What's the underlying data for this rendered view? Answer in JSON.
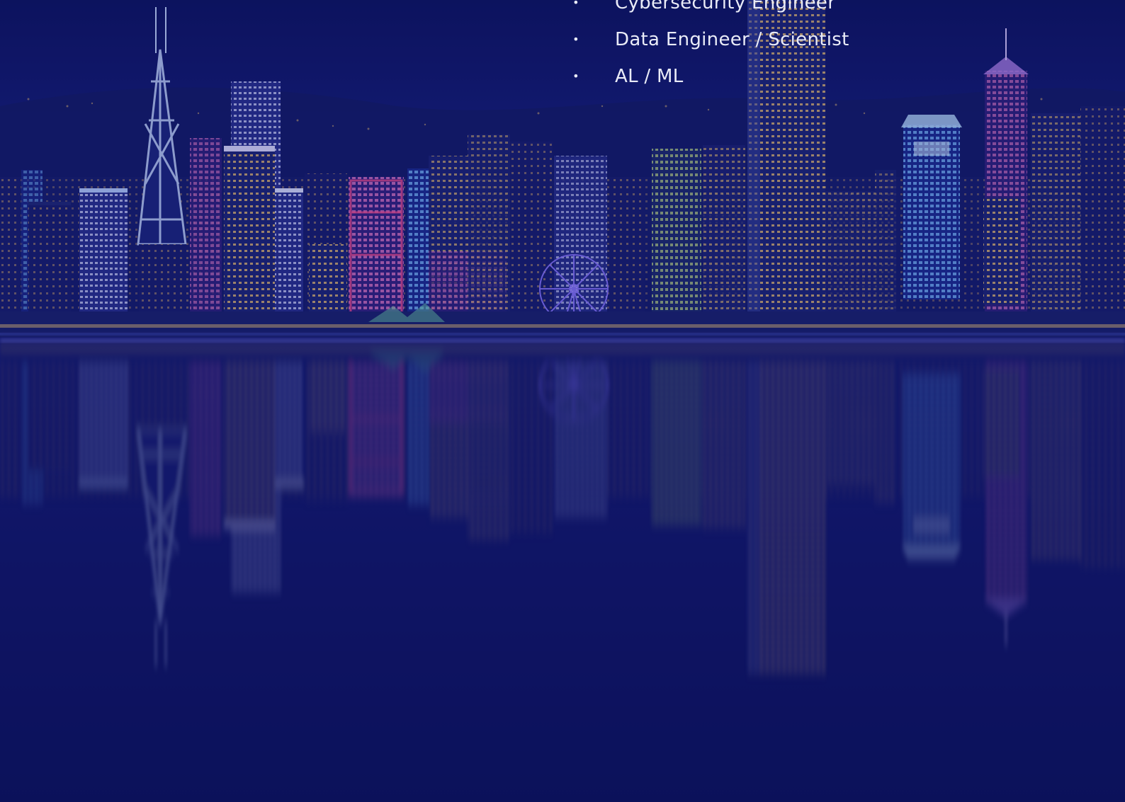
{
  "roles": {
    "items": [
      {
        "label": "Cybersecurity Engineer"
      },
      {
        "label": "Data Engineer / Scientist"
      },
      {
        "label": "AL / ML"
      }
    ],
    "bullet": "•"
  },
  "colors": {
    "background": "#0d1460",
    "text": "#e9ebf7",
    "neon_blue": "#4f7cff",
    "neon_pink": "#ff4fa0",
    "neon_gold": "#ffd36b"
  }
}
